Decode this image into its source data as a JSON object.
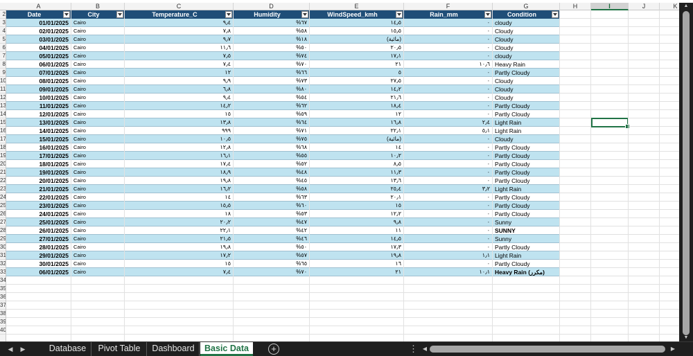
{
  "column_headers": [
    "A",
    "B",
    "C",
    "D",
    "E",
    "F",
    "G",
    "H",
    "I",
    "J",
    "K"
  ],
  "selected_column": "I",
  "row_numbers_visible": [
    "2",
    "3",
    "4",
    "5",
    "6",
    "7",
    "8",
    "9",
    "10",
    "11",
    "12",
    "13",
    "14",
    "15",
    "16",
    "17",
    "18",
    "19",
    "20",
    "21",
    "22",
    "23",
    "24",
    "25",
    "26",
    "27",
    "28",
    "29",
    "30",
    "31",
    "32",
    "33",
    "34",
    "35",
    "36",
    "37",
    "38",
    "39",
    "40"
  ],
  "table": {
    "headers": [
      "Date",
      "City",
      "Temperature_C",
      "Humidity",
      "WindSpeed_kmh",
      "Rain_mm",
      "Condition"
    ],
    "rows": [
      [
        "01/01/2025",
        "Cairo",
        "٩٫٤",
        "%٦٧",
        "١٤٫٥",
        "٠",
        "cloudy"
      ],
      [
        "02/01/2025",
        "Cairo",
        "٧٫٨",
        "%٥٨",
        "١٥٫٥",
        "٠",
        "Cloudy"
      ],
      [
        "03/01/2025",
        "Cairo",
        "٩٫٧",
        "%١٨",
        "(مائية)",
        "٠",
        "Cloudy"
      ],
      [
        "04/01/2025",
        "Cairo",
        "١١٫٦",
        "%٥٠",
        "٢٠٫٥",
        "٠",
        "Cloudy"
      ],
      [
        "05/01/2025",
        "Cairo",
        "٧٫٥",
        "%٧٤",
        "١٧٫١",
        "٠",
        "cloudy"
      ],
      [
        "06/01/2025",
        "Cairo",
        "٧٫٤",
        "%٧٠",
        "٢١",
        "١٠٫٦",
        "Heavy Rain"
      ],
      [
        "07/01/2025",
        "Cairo",
        "١٢",
        "%٦٦",
        "٥",
        "٠",
        "Partly Cloudy"
      ],
      [
        "08/01/2025",
        "Cairo",
        "٩٫٩",
        "%٧٣",
        "٢٧٫٥",
        "٠",
        "Cloudy"
      ],
      [
        "09/01/2025",
        "Cairo",
        "٦٫٨",
        "%٨٠",
        "١٤٫٢",
        "٠",
        "Cloudy"
      ],
      [
        "10/01/2025",
        "Cairo",
        "٩٫٤",
        "%٥٤",
        "٢١٫٦",
        "٠",
        "Cloudy"
      ],
      [
        "11/01/2025",
        "Cairo",
        "١٤٫٢",
        "%٦٢",
        "١٨٫٤",
        "٠",
        "Partly Cloudy"
      ],
      [
        "12/01/2025",
        "Cairo",
        "١٥",
        "%٥٩",
        "١٢",
        "٠",
        "Partly Cloudy"
      ],
      [
        "13/01/2025",
        "Cairo",
        "١٣٫٨",
        "%٦٤",
        "١٦٫٨",
        "٢٫٤",
        "Light Rain"
      ],
      [
        "14/01/2025",
        "Cairo",
        "٩٩٩",
        "%٧١",
        "٢٢٫١",
        "٥٫١",
        "Light Rain"
      ],
      [
        "15/01/2025",
        "Cairo",
        "١٠٫٥",
        "%٧٥",
        "(مائية)",
        "٠",
        "Cloudy"
      ],
      [
        "16/01/2025",
        "Cairo",
        "١٢٫٨",
        "%٦٨",
        "١٤",
        "٠",
        "Partly Cloudy"
      ],
      [
        "17/01/2025",
        "Cairo",
        "١٦٫١",
        "%٥٥",
        "١٠٫٢",
        "٠",
        "Partly Cloudy"
      ],
      [
        "18/01/2025",
        "Cairo",
        "١٧٫٤",
        "%٥٢",
        "٨٫٥",
        "٠",
        "Partly Cloudy"
      ],
      [
        "19/01/2025",
        "Cairo",
        "١٨٫٩",
        "%٤٨",
        "١١٫٣",
        "٠",
        "Partly Cloudy"
      ],
      [
        "20/01/2025",
        "Cairo",
        "١٩٫٨",
        "%٤٥",
        "١٣٫٦",
        "٠",
        "Partly Cloudy"
      ],
      [
        "21/01/2025",
        "Cairo",
        "١٦٫٢",
        "%٥٨",
        "٢٥٫٤",
        "٣٫٢",
        "Light Rain"
      ],
      [
        "22/01/2025",
        "Cairo",
        "١٤",
        "%٦٣",
        "٢٠٫١",
        "٠",
        "Partly Cloudy"
      ],
      [
        "23/01/2025",
        "Cairo",
        "١٥٫٥",
        "%٦٠",
        "١٥",
        "٠",
        "Partly Cloudy"
      ],
      [
        "24/01/2025",
        "Cairo",
        "١٨",
        "%٥٣",
        "١٢٫٢",
        "٠",
        "Partly Cloudy"
      ],
      [
        "25/01/2025",
        "Cairo",
        "٢٠٫٢",
        "%٤٧",
        "٩٫٨",
        "٠",
        "Sunny"
      ],
      [
        "26/01/2025",
        "Cairo",
        "٢٢٫١",
        "%٤٢",
        "١١",
        "٠",
        "SUNNY"
      ],
      [
        "27/01/2025",
        "Cairo",
        "٢١٫٥",
        "%٤٦",
        "١٤٫٥",
        "٠",
        "Sunny"
      ],
      [
        "28/01/2025",
        "Cairo",
        "١٩٫٨",
        "%٥٠",
        "١٧٫٣",
        "٠",
        "Partly Cloudy"
      ],
      [
        "29/01/2025",
        "Cairo",
        "١٧٫٢",
        "%٥٧",
        "١٩٫٨",
        "١٫١",
        "Light Rain"
      ],
      [
        "30/01/2025",
        "Cairo",
        "١٥",
        "%٦٥",
        "١٦",
        "٠",
        "Partly Cloudy"
      ],
      [
        "06/01/2025",
        "Cairo",
        "٧٫٤",
        "%٧٠",
        "٢١",
        "١٠٫١",
        "Heavy Rain (مكرر)"
      ]
    ],
    "bold_conditions": [
      "SUNNY",
      "Heavy Rain (مكرر)"
    ]
  },
  "sheet_tabs": [
    "Database",
    "Pivot Table",
    "Dashboard",
    "Basic Data"
  ],
  "active_tab": "Basic Data",
  "colors": {
    "header_fill": "#1f4e78",
    "band_fill": "#bfe3f0",
    "accent": "#217346"
  },
  "icons": {
    "filter": "chevron-down-icon",
    "add_sheet": "plus-icon",
    "nav_prev": "triangle-left-icon",
    "nav_next": "triangle-right-icon",
    "options": "vertical-ellipsis-icon"
  }
}
